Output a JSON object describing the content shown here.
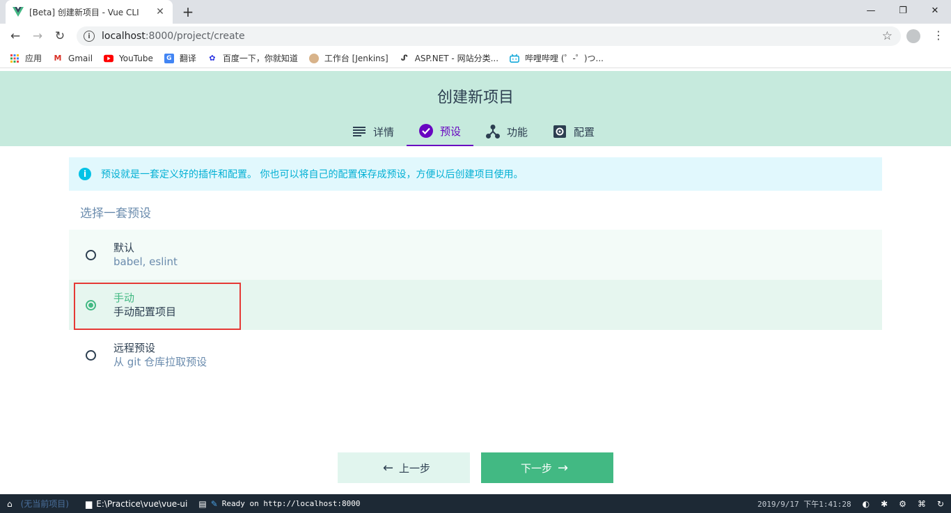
{
  "browser": {
    "tab_title": "[Beta] 创建新项目 - Vue CLI",
    "url_host": "localhost",
    "url_rest": ":8000/project/create",
    "bookmarks": [
      {
        "label": "应用",
        "icon": "apps-grid-icon"
      },
      {
        "label": "Gmail",
        "icon": "gmail-icon"
      },
      {
        "label": "YouTube",
        "icon": "youtube-icon"
      },
      {
        "label": "翻译",
        "icon": "translate-icon"
      },
      {
        "label": "百度一下，你就知道",
        "icon": "baidu-icon"
      },
      {
        "label": "工作台 [Jenkins]",
        "icon": "jenkins-icon"
      },
      {
        "label": "ASP.NET - 网站分类...",
        "icon": "aspnet-icon"
      },
      {
        "label": "哔哩哔哩 (゜-゜)つ...",
        "icon": "bilibili-icon"
      }
    ]
  },
  "page": {
    "title": "创建新项目",
    "steps": [
      {
        "label": "详情",
        "icon": "list-icon",
        "active": false
      },
      {
        "label": "预设",
        "icon": "check-circle-icon",
        "active": true
      },
      {
        "label": "功能",
        "icon": "features-icon",
        "active": false
      },
      {
        "label": "配置",
        "icon": "gear-icon",
        "active": false
      }
    ],
    "info_text": "预设就是一套定义好的插件和配置。 你也可以将自己的配置保存成预设，方便以后创建项目使用。",
    "section_title": "选择一套预设",
    "presets": [
      {
        "name": "默认",
        "desc": "babel, eslint",
        "selected": false
      },
      {
        "name": "手动",
        "desc": "手动配置项目",
        "selected": true
      },
      {
        "name": "远程预设",
        "desc": "从 git 仓库拉取预设",
        "selected": false
      }
    ],
    "prev_label": "上一步",
    "next_label": "下一步"
  },
  "statusbar": {
    "project": "(无当前项目)",
    "path": "E:\\Practice\\vue\\vue-ui",
    "log": "Ready on http://localhost:8000",
    "datetime": "2019/9/17 下午1:41:28"
  },
  "colors": {
    "accent_green": "#42b983",
    "active_purple": "#6806c1",
    "header_bg": "#c6eadd",
    "info_blue": "#03c2e6",
    "highlight_red": "#e53935"
  }
}
